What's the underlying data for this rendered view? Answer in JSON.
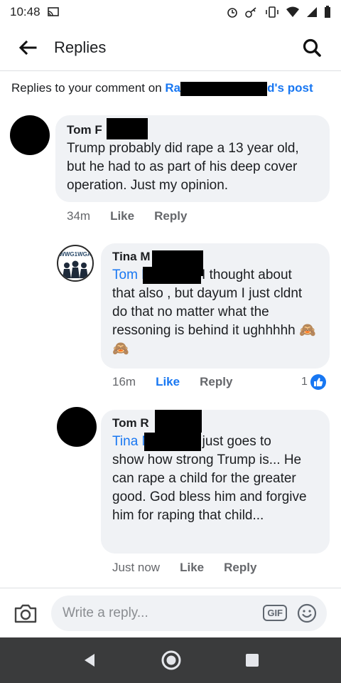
{
  "status": {
    "time": "10:48"
  },
  "header": {
    "title": "Replies"
  },
  "context": {
    "prefix": "Replies to your comment on ",
    "owner_start": "Ra",
    "owner_end": "d's post"
  },
  "comments": [
    {
      "author": "Tom F",
      "text": "Trump probably did rape a 13 year old, but he had to as part of his deep cover operation. Just my opinion.",
      "time": "34m",
      "like": "Like",
      "reply": "Reply"
    },
    {
      "author": "Tina M",
      "avatar_text": "WWG1WGA",
      "tag": "Tom F",
      "text_first": " I thought about",
      "text_rest": "that also , but dayum I just cldnt do that no matter what the ressoning is behind it ughhhhh 🙈🙈",
      "time": "16m",
      "like": "Like",
      "reply": "Reply",
      "reaction_count": "1"
    },
    {
      "author": "Tom R",
      "tag": "Tina M",
      "text_first": " just goes to",
      "text_rest": "show how strong Trump is... He can rape a child for the greater good. God bless him and forgive him for raping that child...",
      "time": "Just now",
      "like": "Like",
      "reply": "Reply"
    }
  ],
  "composer": {
    "placeholder": "Write a reply...",
    "gif": "GIF"
  },
  "icons": {
    "back": "back-arrow-icon",
    "search": "search-icon",
    "camera": "camera-icon",
    "emoji": "emoji-icon",
    "like": "thumbs-up-icon",
    "nav_back": "nav-back-icon",
    "nav_home": "nav-home-icon",
    "nav_recent": "nav-recent-icon"
  },
  "colors": {
    "link": "#1877f2",
    "bubble": "#f0f2f5",
    "secondary_text": "#65676b",
    "nav_bar": "#3a3b3c"
  }
}
